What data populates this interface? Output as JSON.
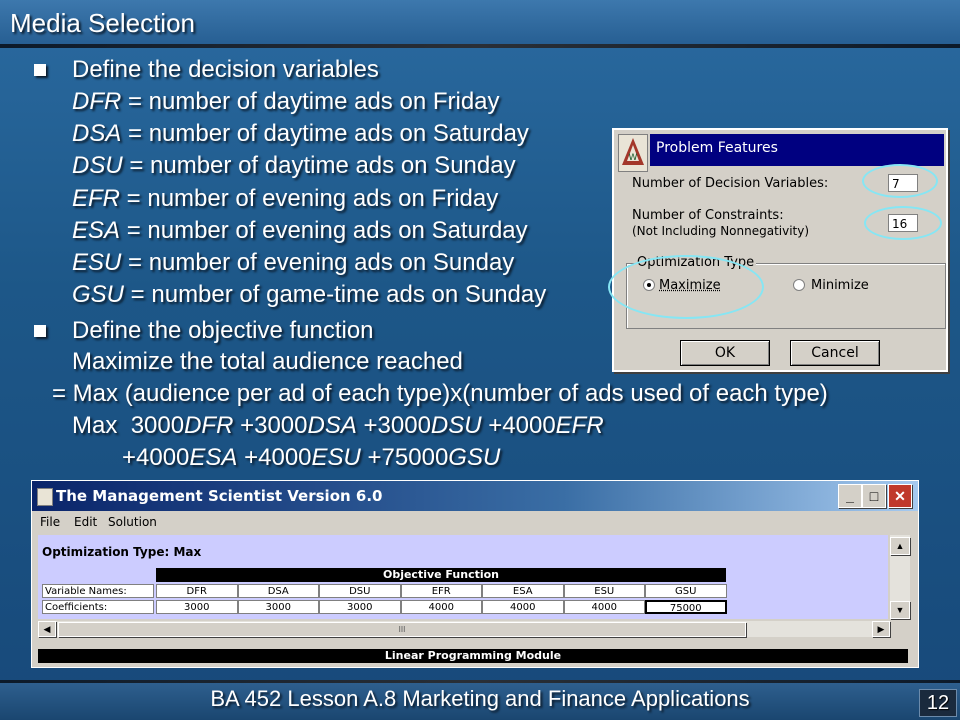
{
  "slide": {
    "title": "Media Selection",
    "footer": "BA 452  Lesson A.8 Marketing and Finance Applications",
    "page_number": "12"
  },
  "bullets": {
    "decision_heading": "Define the decision variables",
    "variables": [
      {
        "name": "DFR",
        "desc": " = number of daytime ads on Friday"
      },
      {
        "name": "DSA",
        "desc": " = number of daytime ads on Saturday"
      },
      {
        "name": "DSU",
        "desc": " = number of daytime ads on Sunday"
      },
      {
        "name": "EFR",
        "desc": " = number of evening ads on Friday"
      },
      {
        "name": "ESA",
        "desc": " = number of evening ads on Saturday"
      },
      {
        "name": "ESU",
        "desc": " = number of evening ads on Sunday"
      },
      {
        "name": "GSU",
        "desc": " = number of game-time ads on Sunday"
      }
    ],
    "objective_heading": "Define the objective function",
    "objective_line1": "Maximize the total audience reached",
    "objective_line2": "= Max  (audience per ad of each type)x(number of ads used of each type)",
    "objective_line3_prefix": "Max  ",
    "objective_terms_line3": [
      {
        "coef": "3000",
        "var": "DFR"
      },
      {
        "coef": " +3000",
        "var": "DSA"
      },
      {
        "coef": " +3000",
        "var": "DSU"
      },
      {
        "coef": " +4000",
        "var": "EFR"
      }
    ],
    "objective_terms_line4": [
      {
        "coef": "+4000",
        "var": "ESA"
      },
      {
        "coef": " +4000",
        "var": "ESU"
      },
      {
        "coef": " +75000",
        "var": "GSU"
      }
    ]
  },
  "dialog": {
    "title": "Problem Features",
    "num_vars_label": "Number of Decision Variables:",
    "num_vars_value": "7",
    "num_constraints_label": "Number of Constraints:",
    "num_constraints_sub": "(Not Including Nonnegativity)",
    "num_constraints_value": "16",
    "group_label": "Optimization Type",
    "maximize_label": "Maximize",
    "minimize_label": "Minimize",
    "selected": "Maximize",
    "ok_label": "OK",
    "cancel_label": "Cancel",
    "highlight_color": "#86e6f4"
  },
  "window": {
    "title": "The Management Scientist Version 6.0",
    "menus": [
      "File",
      "Edit",
      "Solution"
    ],
    "optimization_type": "Optimization Type:  Max",
    "objective_header": "Objective Function",
    "row_labels": [
      "Variable Names:",
      "Coefficients:"
    ],
    "variable_names": [
      "DFR",
      "DSA",
      "DSU",
      "EFR",
      "ESA",
      "ESU",
      "GSU"
    ],
    "coefficients": [
      "3000",
      "3000",
      "3000",
      "4000",
      "4000",
      "4000",
      "75000"
    ],
    "module_label": "Linear Programming Module",
    "hscroll_thumb": "III"
  }
}
